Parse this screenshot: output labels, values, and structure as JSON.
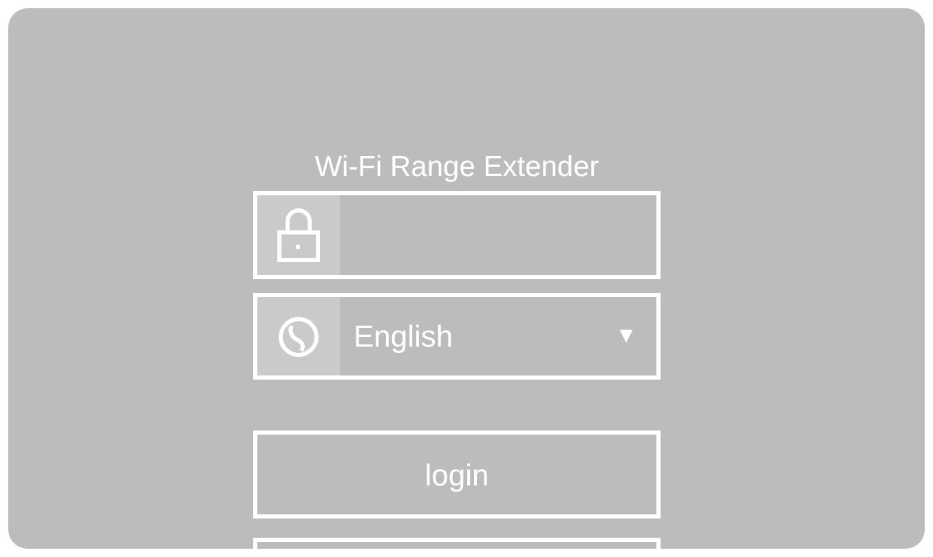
{
  "title": "Wi-Fi Range Extender",
  "language_select": {
    "value": "English",
    "arrow": "▼"
  },
  "login_button": {
    "label": "login"
  }
}
